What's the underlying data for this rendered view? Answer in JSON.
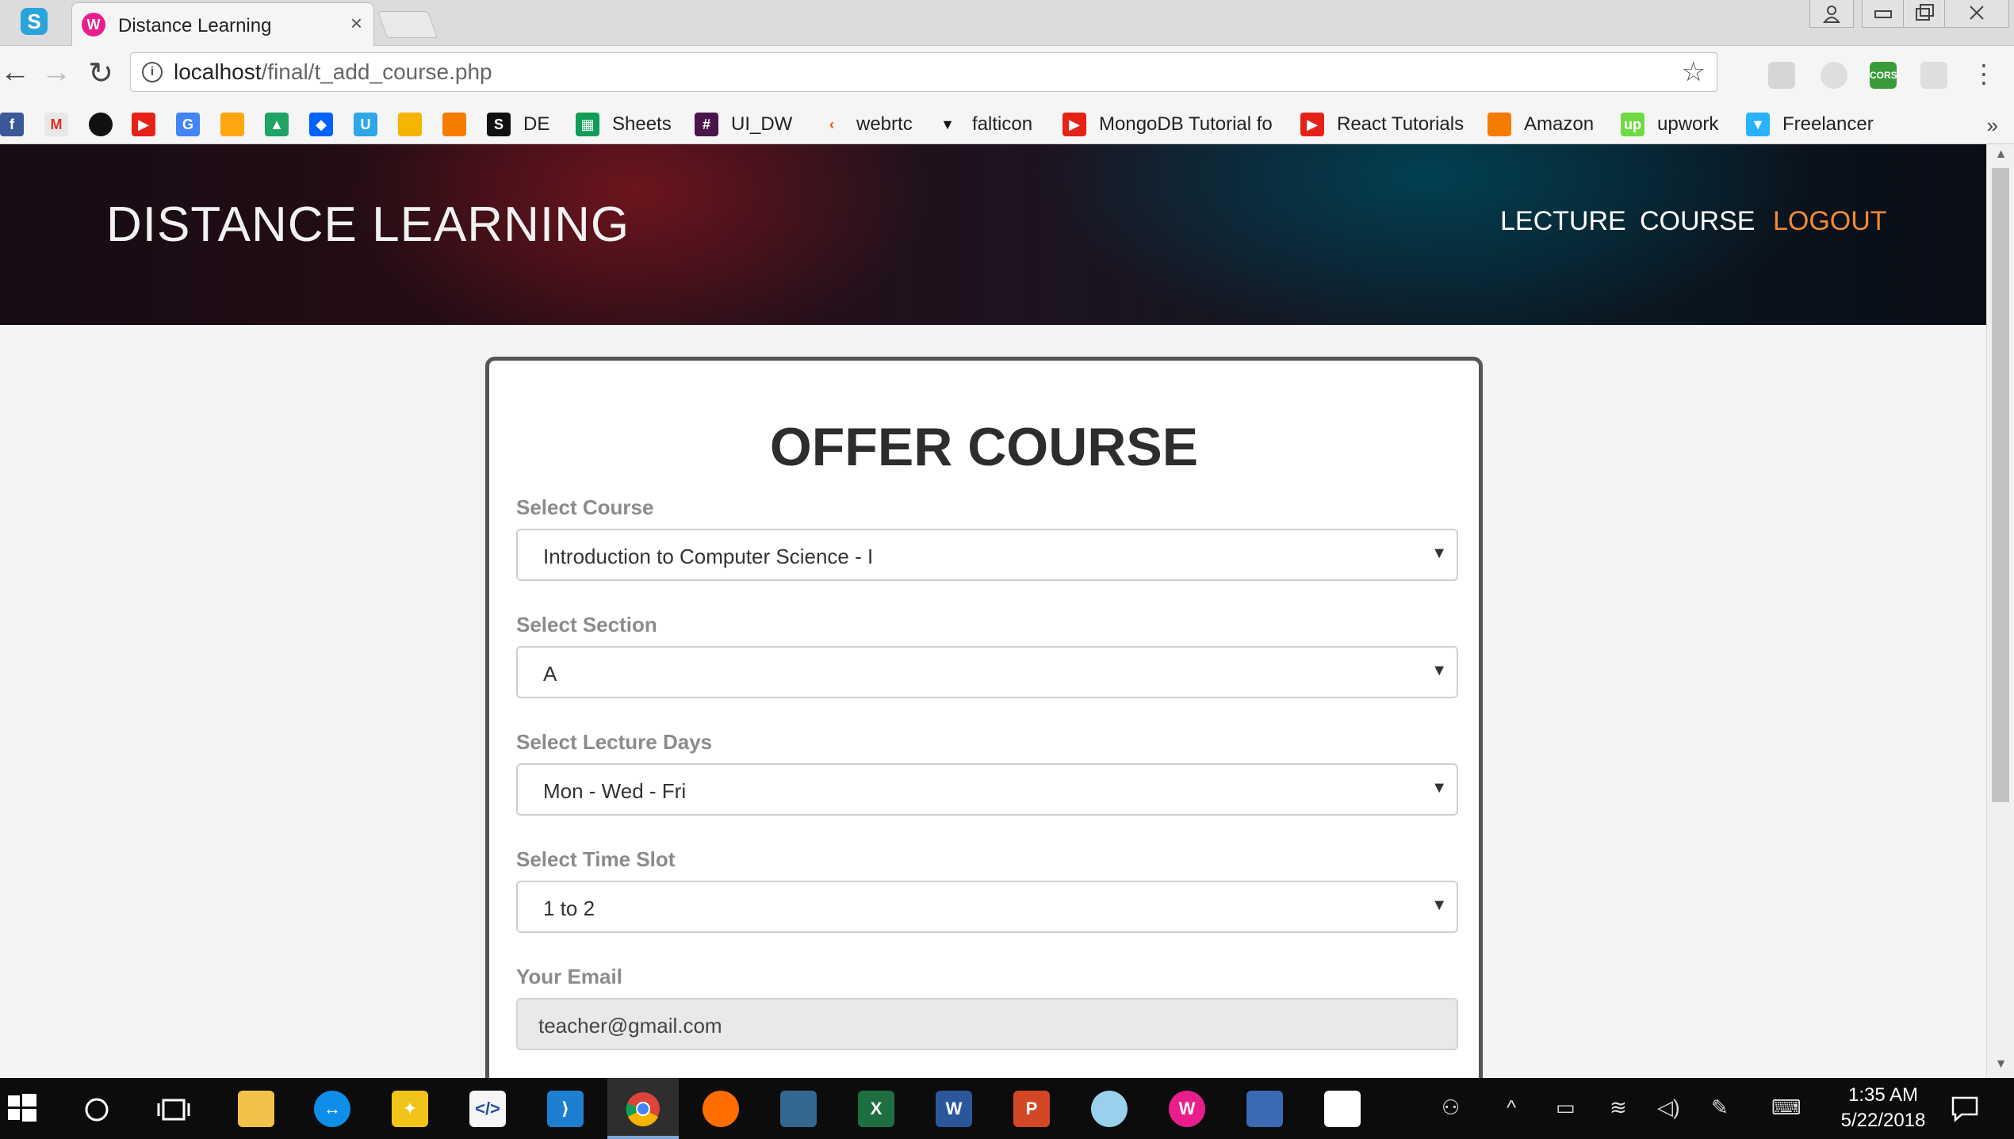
{
  "browser": {
    "tab_title": "Distance Learning",
    "tab_close": "×",
    "url_host": "localhost",
    "url_path": "/final/t_add_course.php",
    "info": "i",
    "star": "☆",
    "menu": "⋮",
    "back": "←",
    "forward": "→",
    "reload": "↻",
    "bookmarks": [
      {
        "label": "",
        "icon": "facebook-icon"
      },
      {
        "label": "",
        "icon": "gmail-icon"
      },
      {
        "label": "",
        "icon": "github-icon"
      },
      {
        "label": "",
        "icon": "youtube-icon"
      },
      {
        "label": "",
        "icon": "google-translate-icon"
      },
      {
        "label": "",
        "icon": "firebase-icon"
      },
      {
        "label": "",
        "icon": "google-drive-icon"
      },
      {
        "label": "",
        "icon": "dropbox-icon"
      },
      {
        "label": "",
        "icon": "webflow-icon"
      },
      {
        "label": "",
        "icon": "google-classroom-icon"
      },
      {
        "label": "",
        "icon": "box-icon"
      },
      {
        "label": "DE",
        "icon": "s-icon"
      },
      {
        "label": "Sheets",
        "icon": "sheets-icon"
      },
      {
        "label": "UI_DW",
        "icon": "hash-icon"
      },
      {
        "label": "webrtc",
        "icon": "webrtc-icon"
      },
      {
        "label": "falticon",
        "icon": "flaticon-icon"
      },
      {
        "label": "MongoDB Tutorial fo",
        "icon": "youtube-icon"
      },
      {
        "label": "React Tutorials",
        "icon": "youtube-icon"
      },
      {
        "label": "Amazon",
        "icon": "amazon-icon"
      },
      {
        "label": "upwork",
        "icon": "upwork-icon"
      },
      {
        "label": "Freelancer",
        "icon": "freelancer-icon"
      }
    ],
    "bookmarks_more": "»"
  },
  "site": {
    "brand": "DISTANCE LEARNING",
    "nav": {
      "lecture": "LECTURE",
      "course": "COURSE",
      "logout": "LOGOUT"
    }
  },
  "form": {
    "title": "OFFER COURSE",
    "course_label": "Select Course",
    "course_value": "Introduction to Computer Science - I",
    "section_label": "Select Section",
    "section_value": "A",
    "days_label": "Select Lecture Days",
    "days_value": "Mon - Wed - Fri",
    "slot_label": "Select Time Slot",
    "slot_value": "1 to 2",
    "email_label": "Your Email",
    "email_value": "teacher@gmail.com",
    "caret": "▼"
  },
  "taskbar": {
    "time": "1:35 AM",
    "date": "5/22/2018"
  },
  "colors": {
    "logout": "#f08a3a",
    "label": "#8b8b8b"
  }
}
